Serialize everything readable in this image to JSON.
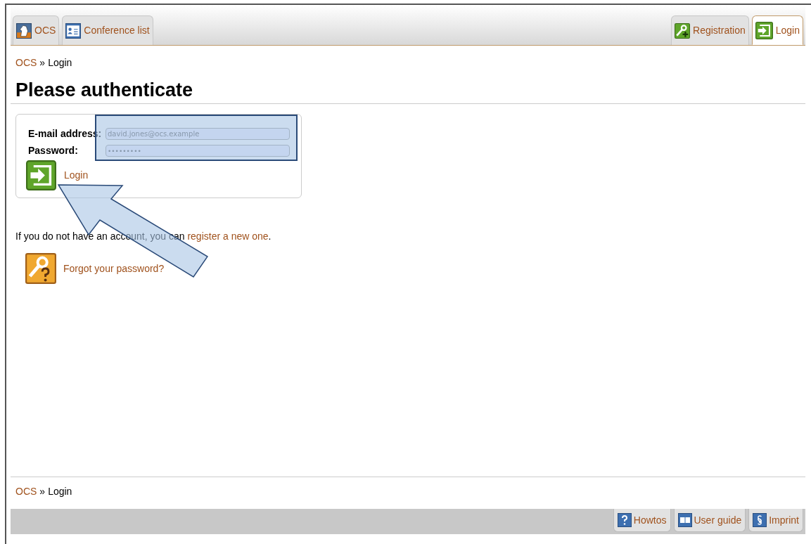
{
  "tabs_left": [
    {
      "label": "OCS",
      "kind": "knight",
      "selected": false
    },
    {
      "label": "Conference list",
      "kind": "list",
      "selected": false
    }
  ],
  "tabs_right": [
    {
      "label": "Registration",
      "kind": "key-plus",
      "selected": false
    },
    {
      "label": "Login",
      "kind": "enter",
      "selected": true
    }
  ],
  "breadcrumb": {
    "link": "OCS",
    "separator": "»",
    "current": "Login"
  },
  "heading": "Please authenticate",
  "form": {
    "email_label": "E-mail address:",
    "email_value": "david.jones@ocs.example",
    "password_label": "Password:",
    "password_value": "•••••••••",
    "submit": "Login"
  },
  "register_text": {
    "before": "If you do not have an account, you can ",
    "link": "register a new one",
    "after": "."
  },
  "forgot": "Forgot your password?",
  "footer_breadcrumb": {
    "link": "OCS",
    "separator": "»",
    "current": "Login"
  },
  "footer_tabs": [
    {
      "label": "Howtos",
      "kind": "question"
    },
    {
      "label": "User guide",
      "kind": "book"
    },
    {
      "label": "Imprint",
      "kind": "section"
    }
  ]
}
